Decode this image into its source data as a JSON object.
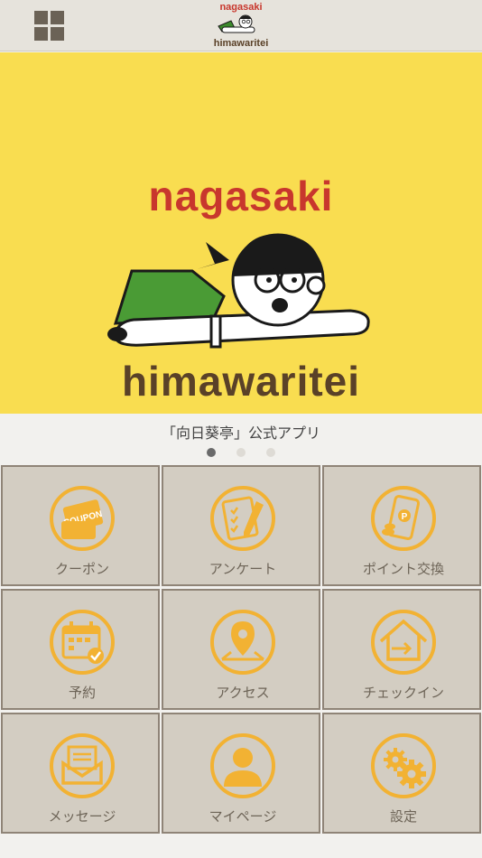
{
  "header": {
    "menu_icon": "grid-menu-icon",
    "logo_top": "nagasaki",
    "logo_bottom": "himawaritei"
  },
  "banner": {
    "title_top": "nagasaki",
    "title_bottom": "himawaritei",
    "caption": "「向日葵亭」公式アプリ",
    "page_count": 3,
    "active_page": 1
  },
  "menu": {
    "accent": "#f2b233",
    "items": [
      {
        "label": "クーポン",
        "icon": "coupon-icon"
      },
      {
        "label": "アンケート",
        "icon": "survey-icon"
      },
      {
        "label": "ポイント交換",
        "icon": "point-exchange-icon"
      },
      {
        "label": "予約",
        "icon": "reservation-calendar-icon"
      },
      {
        "label": "アクセス",
        "icon": "map-pin-icon"
      },
      {
        "label": "チェックイン",
        "icon": "checkin-icon"
      },
      {
        "label": "メッセージ",
        "icon": "message-icon"
      },
      {
        "label": "マイページ",
        "icon": "user-icon"
      },
      {
        "label": "設定",
        "icon": "settings-gear-icon"
      }
    ]
  },
  "colors": {
    "banner_bg": "#f9dd50",
    "brand_red": "#c8372d",
    "brand_brown": "#5a4128",
    "tile_bg": "#d3cdc2"
  }
}
